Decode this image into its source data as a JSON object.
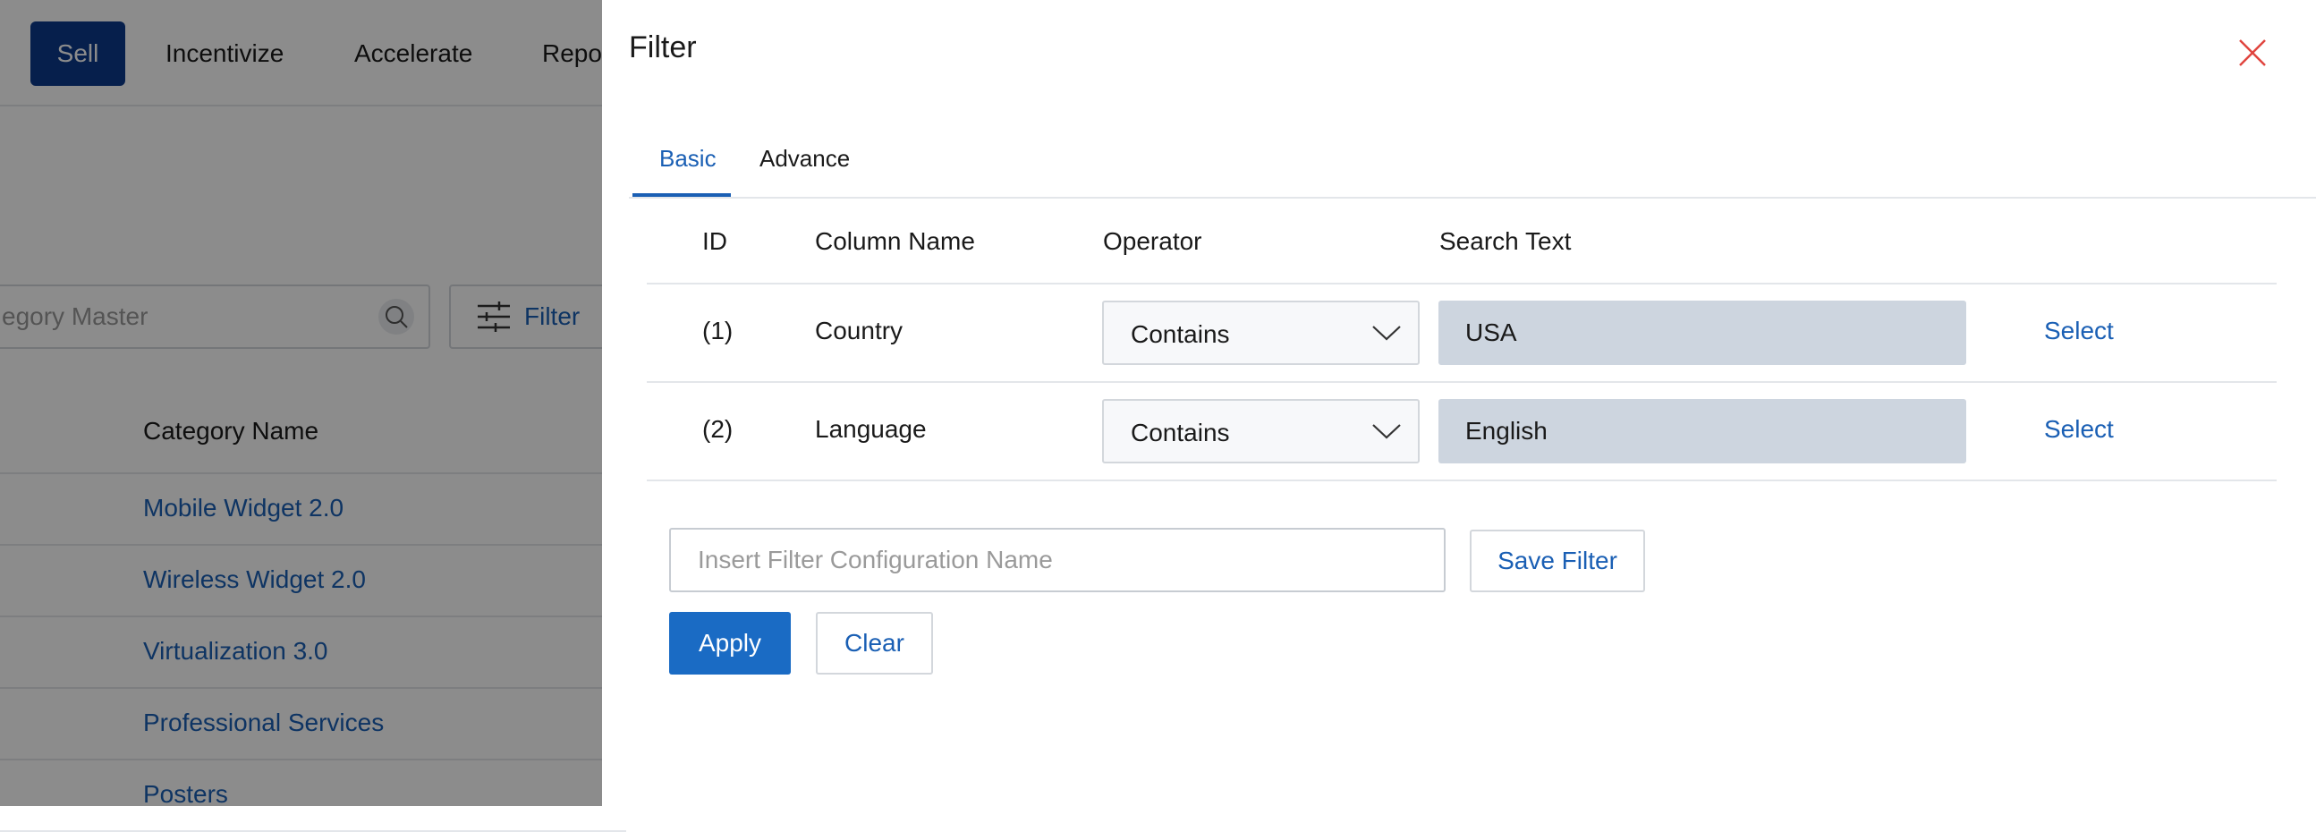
{
  "nav": {
    "items": [
      {
        "label": "Sell",
        "active": true
      },
      {
        "label": "Incentivize"
      },
      {
        "label": "Accelerate"
      },
      {
        "label": "Repor"
      }
    ]
  },
  "background": {
    "search": {
      "placeholder": "egory Master",
      "icon": "search-icon"
    },
    "filter_button": {
      "label": "Filter",
      "icon": "filter-sliders-icon"
    },
    "table": {
      "header": "Category Name",
      "rows": [
        "Mobile Widget 2.0",
        "Wireless Widget 2.0",
        "Virtualization 3.0",
        "Professional Services",
        "Posters"
      ]
    }
  },
  "drawer": {
    "title": "Filter",
    "close_icon": "close-icon",
    "tabs": [
      {
        "label": "Basic",
        "active": true
      },
      {
        "label": "Advance"
      }
    ],
    "columns": {
      "id": "ID",
      "column_name": "Column Name",
      "operator": "Operator",
      "search_text": "Search Text"
    },
    "rows": [
      {
        "id": "(1)",
        "column": "Country",
        "operator": "Contains",
        "search_text": "USA",
        "action": "Select"
      },
      {
        "id": "(2)",
        "column": "Language",
        "operator": "Contains",
        "search_text": "English",
        "action": "Select"
      }
    ],
    "config_input": {
      "placeholder": "Insert Filter Configuration Name",
      "value": ""
    },
    "save_filter_label": "Save Filter",
    "apply_label": "Apply",
    "clear_label": "Clear"
  },
  "colors": {
    "primary": "#1a6bc4",
    "nav_active": "#0b3a8a",
    "link": "#1a5fb4",
    "close": "#e0443e",
    "search_text_bg": "#cdd5df"
  }
}
